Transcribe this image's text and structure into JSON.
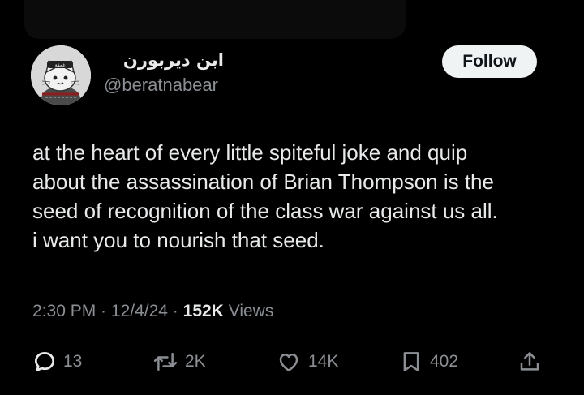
{
  "tweet": {
    "author": {
      "display_name": "ابن ديربورن",
      "handle": "@beratnabear",
      "avatar_badge": "غمفة"
    },
    "follow_label": "Follow",
    "text_lines": [
      "at the heart of every little spiteful joke and quip",
      "about the assassination of Brian Thompson is the",
      "seed of recognition of the class war against us all.",
      "i want you to nourish that seed."
    ],
    "meta": {
      "time": "2:30 PM",
      "date": "12/4/24",
      "views_count": "152K",
      "views_label": "Views",
      "separator": " · "
    },
    "actions": {
      "replies": "13",
      "reposts": "2K",
      "likes": "14K",
      "bookmarks": "402"
    }
  },
  "colors": {
    "background": "#000000",
    "primary_text": "#e7e9ea",
    "secondary_text": "#8b8f94",
    "follow_bg": "#eff3f4",
    "follow_text": "#0f1419"
  },
  "icons": [
    "reply-icon",
    "repost-icon",
    "like-icon",
    "bookmark-icon",
    "share-icon"
  ]
}
